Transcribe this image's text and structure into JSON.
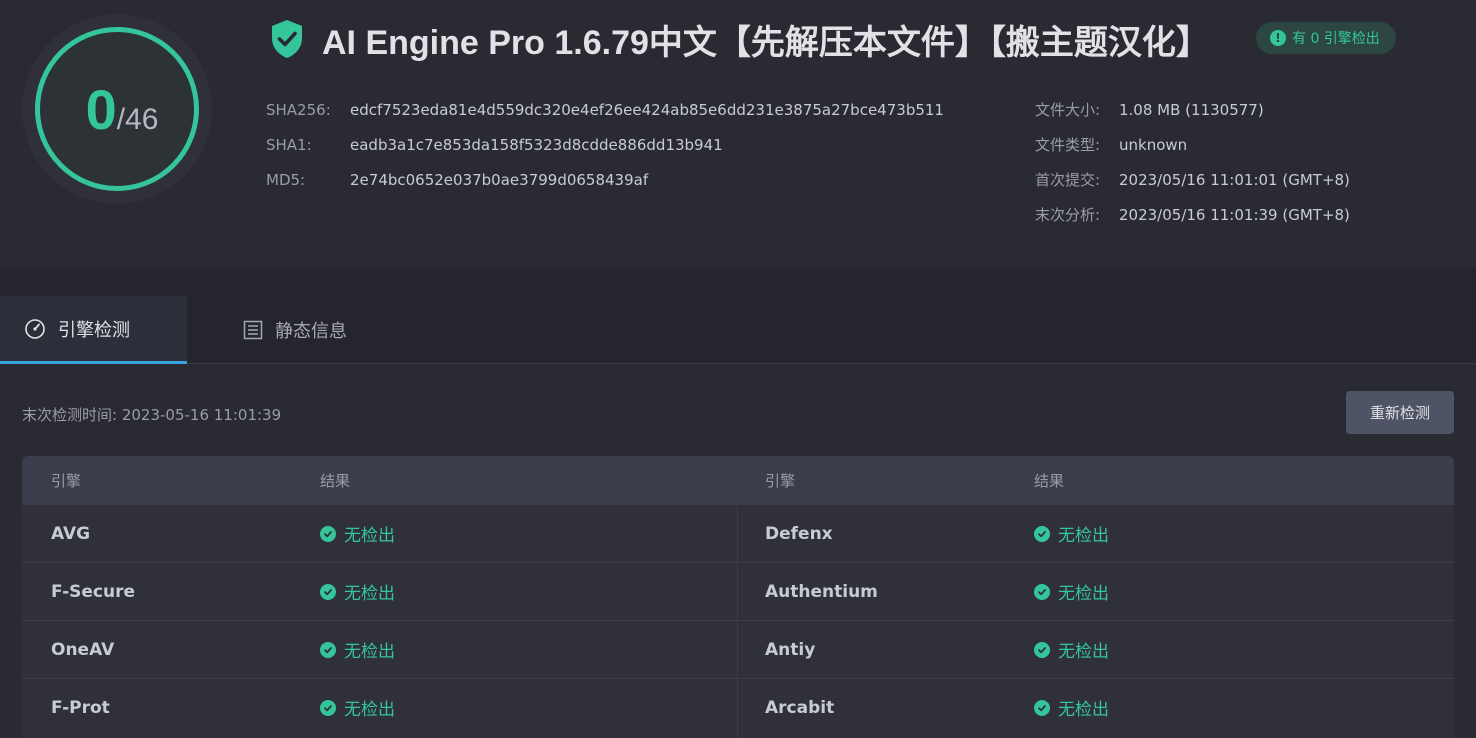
{
  "score": {
    "detected": "0",
    "total": "/46"
  },
  "file": {
    "title": "AI Engine Pro 1.6.79中文【先解压本文件】【搬主题汉化】",
    "badge": "有 0 引擎检出",
    "hashes": [
      {
        "label": "SHA256:",
        "value": "edcf7523eda81e4d559dc320e4ef26ee424ab85e6dd231e3875a27bce473b511"
      },
      {
        "label": "SHA1:",
        "value": "eadb3a1c7e853da158f5323d8cdde886dd13b941"
      },
      {
        "label": "MD5:",
        "value": "2e74bc0652e037b0ae3799d0658439af"
      }
    ],
    "meta": [
      {
        "label": "文件大小:",
        "value": "1.08 MB (1130577)"
      },
      {
        "label": "文件类型:",
        "value": "unknown"
      },
      {
        "label": "首次提交:",
        "value": "2023/05/16 11:01:01 (GMT+8)"
      },
      {
        "label": "末次分析:",
        "value": "2023/05/16 11:01:39 (GMT+8)"
      }
    ]
  },
  "tabs": [
    {
      "label": "引擎检测",
      "icon": "gauge-icon",
      "active": true
    },
    {
      "label": "静态信息",
      "icon": "list-icon",
      "active": false
    }
  ],
  "scan": {
    "last_check": "末次检测时间: 2023-05-16 11:01:39",
    "recheck_label": "重新检测"
  },
  "table": {
    "headers": [
      "引擎",
      "结果",
      "引擎",
      "结果"
    ],
    "rows": [
      {
        "left_engine": "AVG",
        "left_result": "无检出",
        "right_engine": "Defenx",
        "right_result": "无检出"
      },
      {
        "left_engine": "F-Secure",
        "left_result": "无检出",
        "right_engine": "Authentium",
        "right_result": "无检出"
      },
      {
        "left_engine": "OneAV",
        "left_result": "无检出",
        "right_engine": "Antiy",
        "right_result": "无检出"
      },
      {
        "left_engine": "F-Prot",
        "left_result": "无检出",
        "right_engine": "Arcabit",
        "right_result": "无检出"
      }
    ]
  },
  "colors": {
    "accent": "#34c69a",
    "tab_indicator": "#3aa2e0",
    "background": "#2a2a33"
  }
}
